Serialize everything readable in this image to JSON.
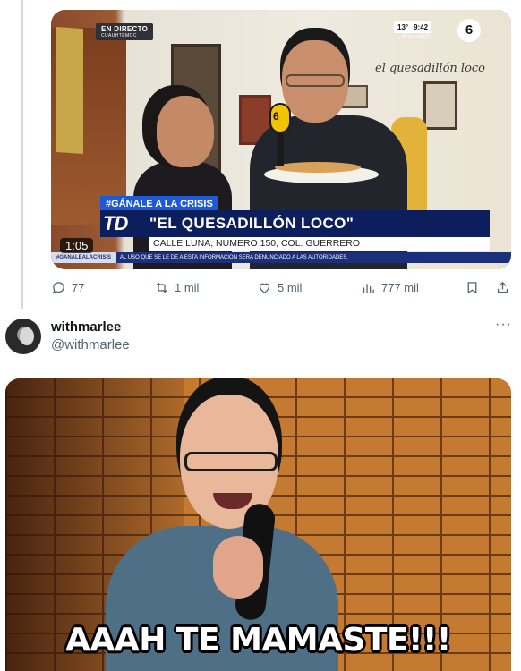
{
  "video": {
    "live_title": "EN DIRECTO",
    "live_location": "CUAUHTÉMOC",
    "temperature": "13°",
    "time": "9:42",
    "corner_hashtag": "#CercaDeTi",
    "channel_logo": "6",
    "wall_sign": "el quesadillón loco",
    "mic_label": "6",
    "lower_third_hashtag": "#GÁNALE A LA CRISIS",
    "lower_third_logo": "TD",
    "lower_third_title": "\"EL QUESADILLÓN LOCO\"",
    "lower_third_address": "CALLE LUNA, NUMERO 150, COL. GUERRERO",
    "ticker_tag": "#GANALEALACRISIS",
    "ticker_text": "AL USO QUE SE LE DE A ESTA INFORMACION SERA DENUNCIADO A LAS AUTORIDADES.",
    "duration": "1:05"
  },
  "actions": {
    "replies": "77",
    "reposts": "1 mil",
    "likes": "5 mil",
    "views": "777 mil"
  },
  "reply": {
    "display_name": "withmarlee",
    "handle": "@withmarlee",
    "more": "···"
  },
  "meme": {
    "caption": "AAAH TE MAMASTE!!!"
  }
}
